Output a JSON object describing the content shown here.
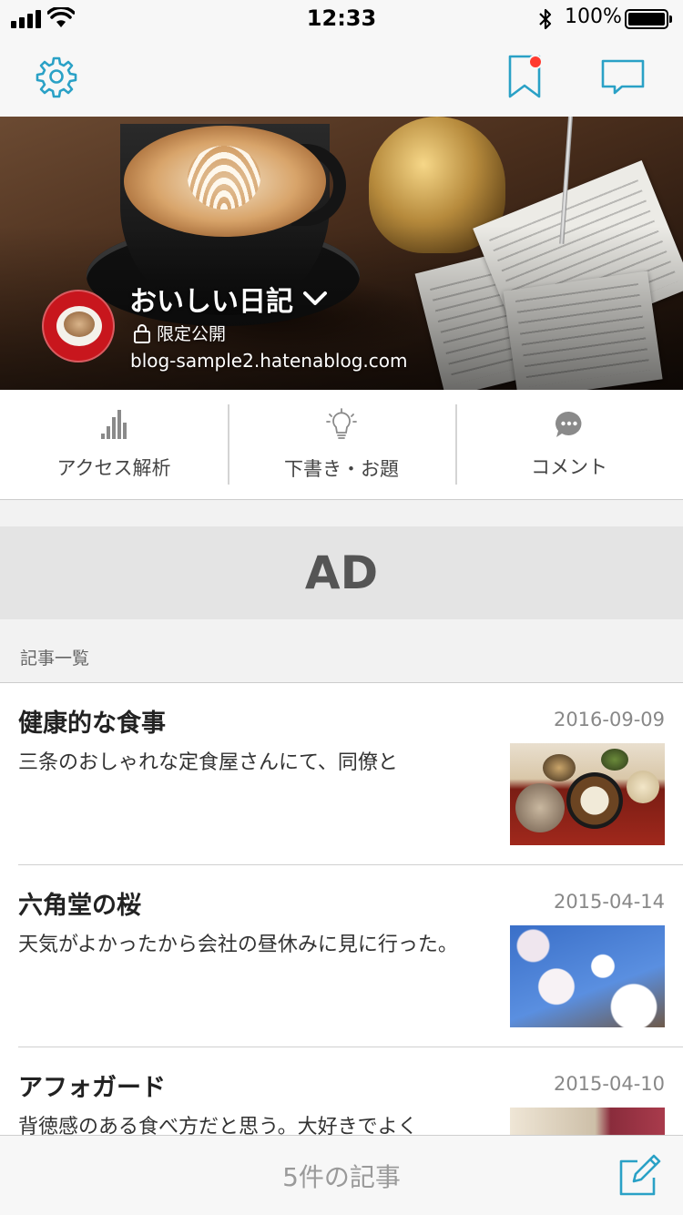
{
  "status_bar": {
    "time": "12:33",
    "battery": "100%"
  },
  "nav": {
    "settings_icon": "gear-icon",
    "bookmark_icon": "bookmark-icon",
    "chat_icon": "chat-bubble-icon",
    "accent_color": "#2aa1c6",
    "badge_color": "#ff3b30"
  },
  "blog": {
    "title": "おいしい日記",
    "privacy": "限定公開",
    "url": "blog-sample2.hatenablog.com"
  },
  "actions": [
    {
      "label": "アクセス解析",
      "icon": "bar-chart-icon"
    },
    {
      "label": "下書き・お題",
      "icon": "lightbulb-icon"
    },
    {
      "label": "コメント",
      "icon": "comment-icon"
    }
  ],
  "ad": {
    "label": "AD"
  },
  "entries_header": "記事一覧",
  "entries": [
    {
      "title": "健康的な食事",
      "date": "2016-09-09",
      "excerpt": "三条のおしゃれな定食屋さんにて、同僚と"
    },
    {
      "title": "六角堂の桜",
      "date": "2015-04-14",
      "excerpt": "天気がよかったから会社の昼休みに見に行った。"
    },
    {
      "title": "アフォガード",
      "date": "2015-04-10",
      "excerpt": "背徳感のある食べ方だと思う。大好きでよく"
    }
  ],
  "toolbar": {
    "count_label": "5件の記事",
    "edit_icon": "compose-icon"
  }
}
